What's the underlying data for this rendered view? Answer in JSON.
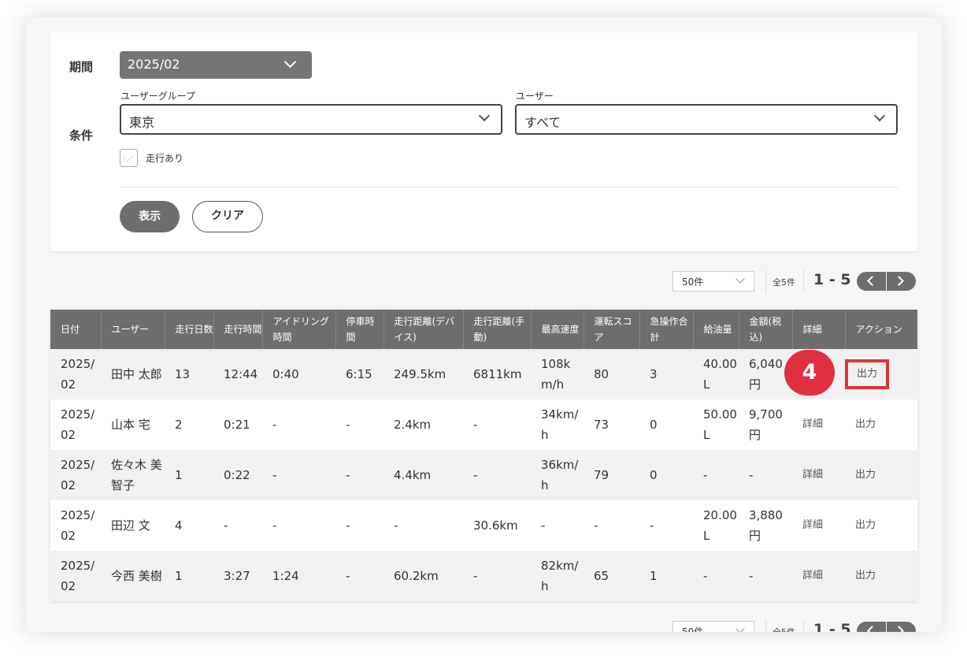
{
  "filter": {
    "period_label": "期間",
    "period_value": "2025/02",
    "condition_label": "条件",
    "group_label": "ユーザーグループ",
    "group_value": "東京",
    "user_label": "ユーザー",
    "user_value": "すべて",
    "checkbox_label": "走行あり",
    "show_button": "表示",
    "clear_button": "クリア"
  },
  "pager": {
    "per_page": "50件",
    "total": "全5件",
    "range": "1 - 5"
  },
  "table": {
    "headers": [
      "日付",
      "ユーザー",
      "走行日数",
      "走行時間",
      "アイドリング時間",
      "停車時間",
      "走行距離(デバイス)",
      "走行距離(手動)",
      "最高速度",
      "運転スコア",
      "急操作合計",
      "給油量",
      "金額(税込)",
      "詳細",
      "アクション"
    ],
    "rows": [
      [
        "2025/02",
        "田中 太郎",
        "13",
        "12:44",
        "0:40",
        "6:15",
        "249.5km",
        "6811km",
        "108km/h",
        "80",
        "3",
        "40.00L",
        "6,040円",
        "",
        "出力"
      ],
      [
        "2025/02",
        "山本 宅",
        "2",
        "0:21",
        "-",
        "-",
        "2.4km",
        "-",
        "34km/h",
        "73",
        "0",
        "50.00L",
        "9,700円",
        "詳細",
        "出力"
      ],
      [
        "2025/02",
        "佐々木 美智子",
        "1",
        "0:22",
        "-",
        "-",
        "4.4km",
        "-",
        "36km/h",
        "79",
        "0",
        "-",
        "-",
        "詳細",
        "出力"
      ],
      [
        "2025/02",
        "田辺 文",
        "4",
        "-",
        "-",
        "-",
        "-",
        "30.6km",
        "-",
        "-",
        "-",
        "20.00L",
        "3,880円",
        "詳細",
        "出力"
      ],
      [
        "2025/02",
        "今西 美樹",
        "1",
        "3:27",
        "1:24",
        "-",
        "60.2km",
        "-",
        "82km/h",
        "65",
        "1",
        "-",
        "-",
        "詳細",
        "出力"
      ]
    ]
  },
  "callout": {
    "number": "4",
    "color": "#e03041"
  },
  "colors": {
    "header_bg": "#6e6e6e",
    "highlight": "#d9343f"
  }
}
